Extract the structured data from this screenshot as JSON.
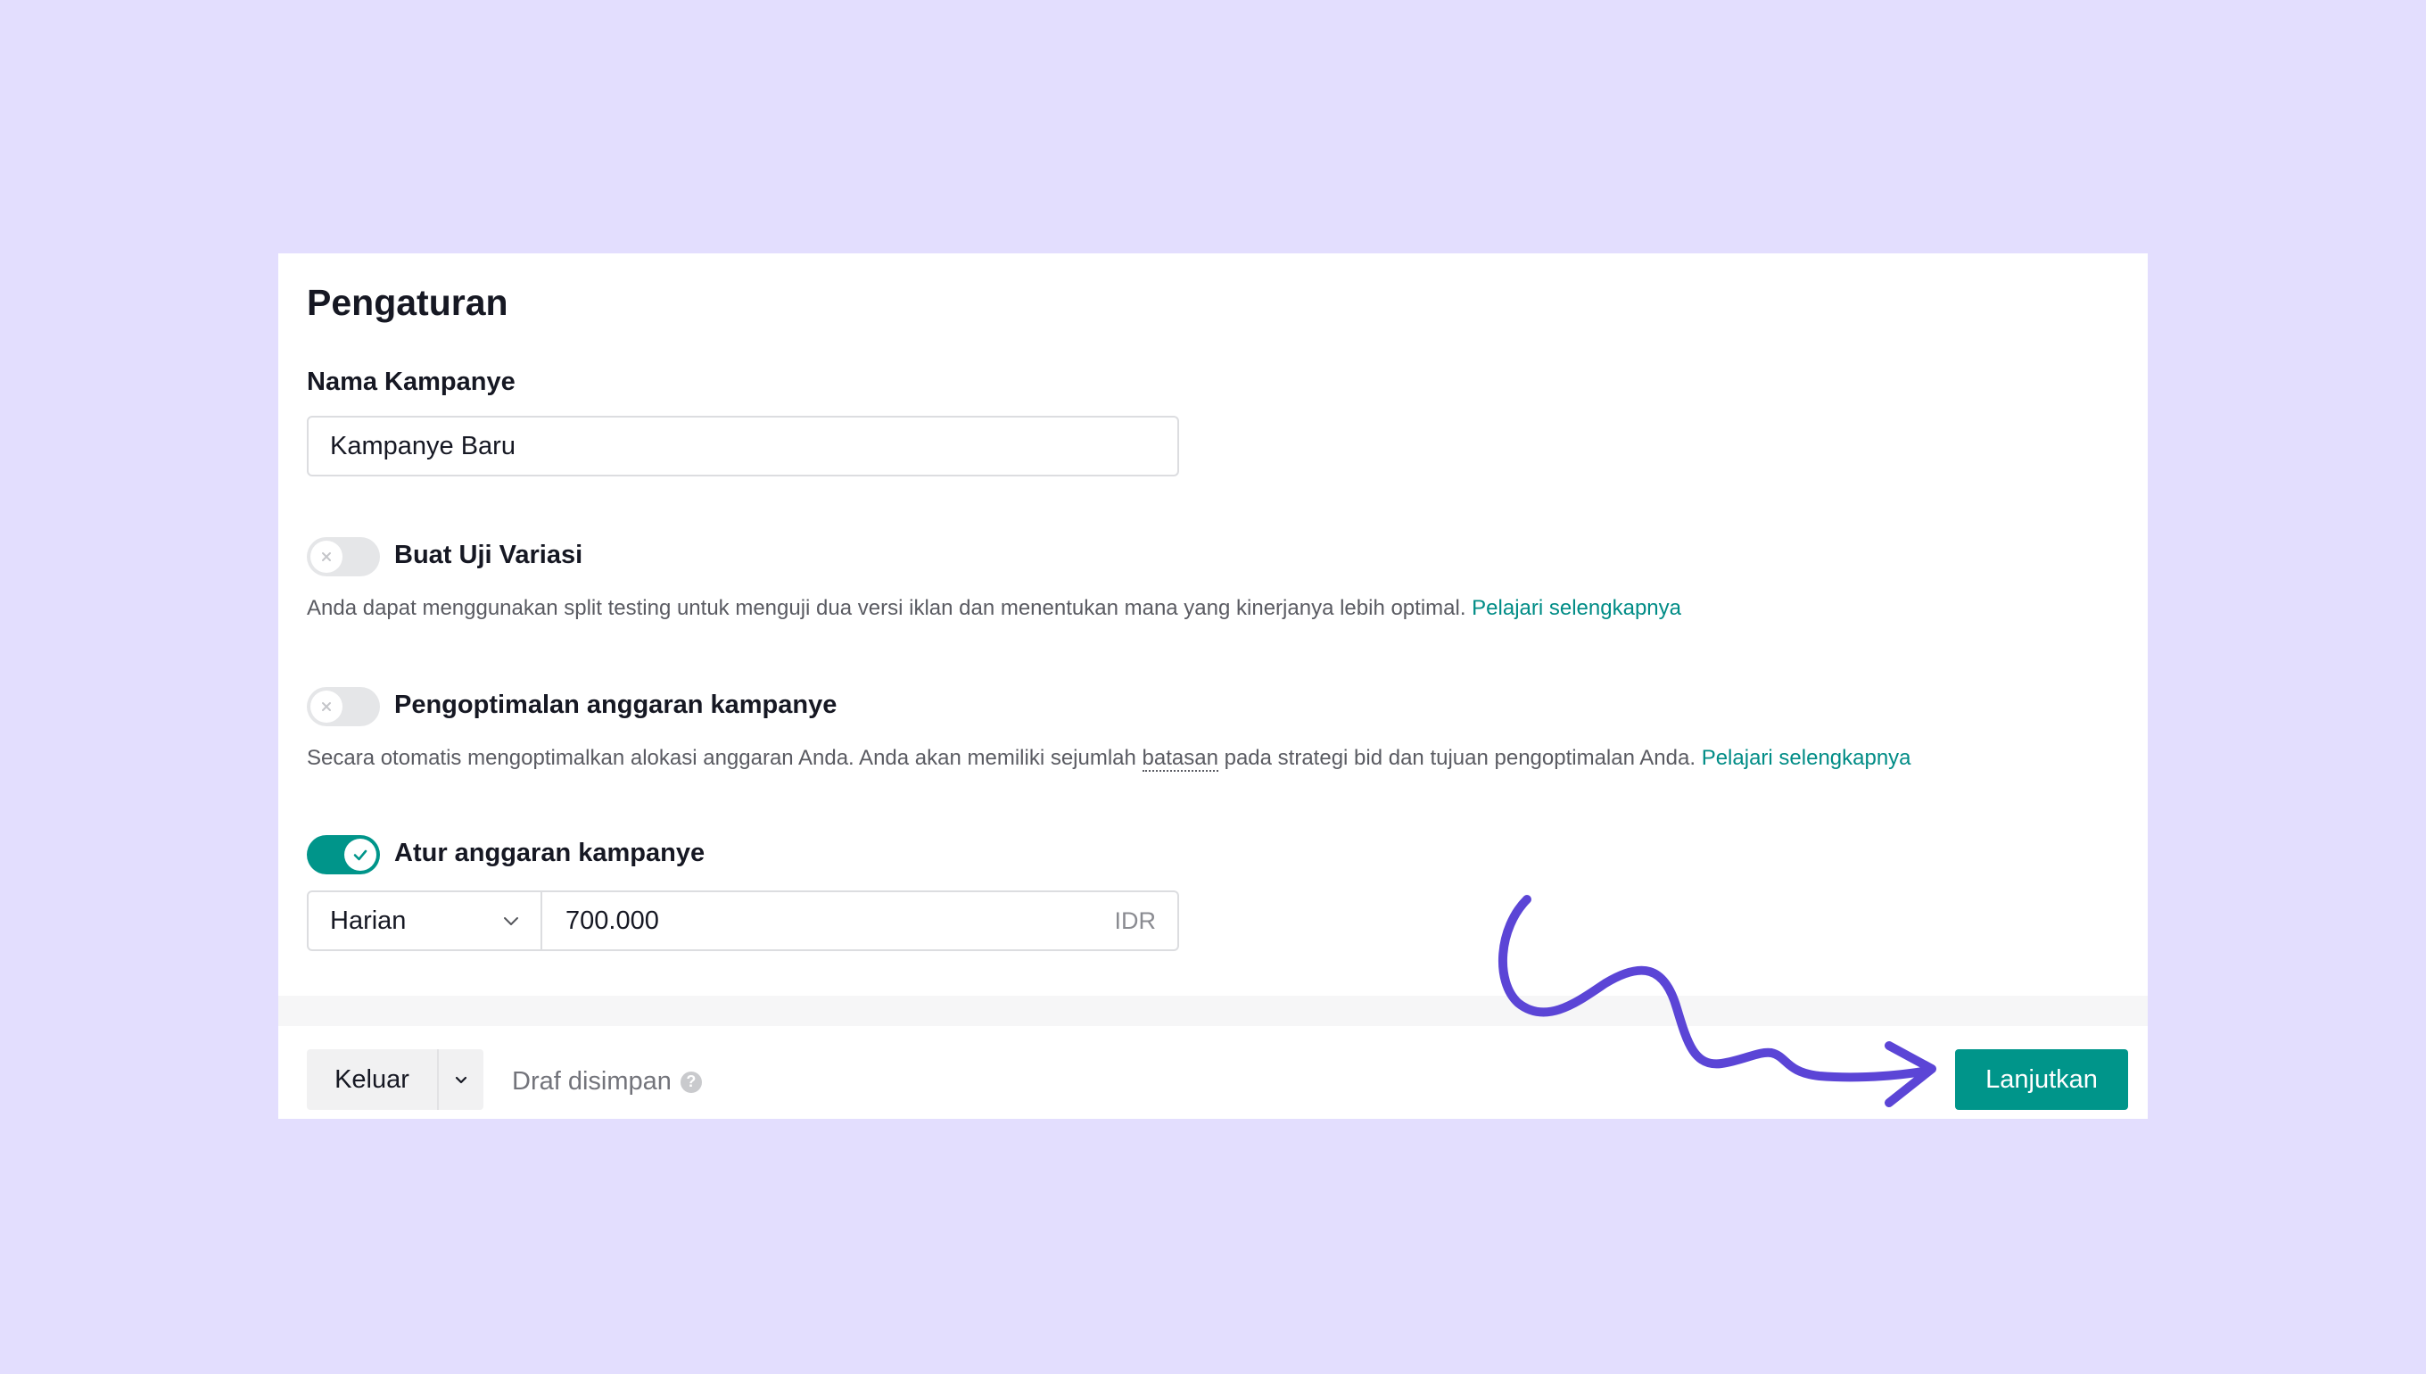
{
  "settings": {
    "title": "Pengaturan",
    "campaign_name": {
      "label": "Nama Kampanye",
      "value": "Kampanye Baru"
    },
    "split_test": {
      "label": "Buat Uji Variasi",
      "enabled": false,
      "description": "Anda dapat menggunakan split testing untuk menguji dua versi iklan dan menentukan mana yang kinerjanya lebih optimal.",
      "link": "Pelajari selengkapnya"
    },
    "budget_optimization": {
      "label": "Pengoptimalan anggaran kampanye",
      "enabled": false,
      "description_before": "Secara otomatis mengoptimalkan alokasi anggaran Anda. Anda akan memiliki sejumlah",
      "description_term": "batasan",
      "description_after": "pada strategi bid dan tujuan pengoptimalan Anda.",
      "link": "Pelajari selengkapnya"
    },
    "campaign_budget": {
      "label": "Atur anggaran kampanye",
      "enabled": true,
      "budget_type": "Harian",
      "amount": "700.000",
      "currency": "IDR"
    }
  },
  "footer": {
    "exit_label": "Keluar",
    "draft_status": "Draf disimpan",
    "help_glyph": "?",
    "continue_label": "Lanjutkan"
  },
  "colors": {
    "page_background": "#e3defe",
    "accent": "#00958a",
    "link": "#008c86",
    "annotation_arrow": "#5b45d6"
  },
  "icons": {
    "toggle_off": "x-icon",
    "toggle_on": "check-icon",
    "select": "chevron-down-icon",
    "help": "question-circle-icon",
    "annotation": "curly-arrow"
  }
}
